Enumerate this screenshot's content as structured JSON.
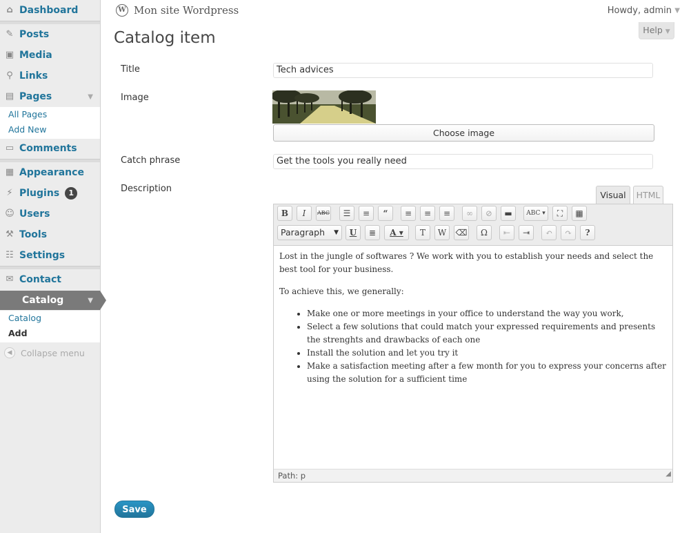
{
  "sidebar": {
    "items": [
      {
        "label": "Dashboard",
        "icon": "dashboard-icon"
      },
      {
        "label": "Posts",
        "icon": "pin-icon"
      },
      {
        "label": "Media",
        "icon": "media-icon"
      },
      {
        "label": "Links",
        "icon": "link-icon"
      },
      {
        "label": "Pages",
        "icon": "pages-icon"
      },
      {
        "label": "Comments",
        "icon": "comment-icon"
      },
      {
        "label": "Appearance",
        "icon": "appearance-icon"
      },
      {
        "label": "Plugins",
        "icon": "plugin-icon",
        "badge": "1"
      },
      {
        "label": "Users",
        "icon": "users-icon"
      },
      {
        "label": "Tools",
        "icon": "tools-icon"
      },
      {
        "label": "Settings",
        "icon": "settings-icon"
      },
      {
        "label": "Contact",
        "icon": "contact-icon"
      },
      {
        "label": "Catalog",
        "icon": "catalog-icon"
      }
    ],
    "pages_submenu": [
      "All Pages",
      "Add New"
    ],
    "catalog_submenu": [
      "Catalog",
      "Add"
    ],
    "collapse_label": "Collapse menu"
  },
  "header": {
    "site_name": "Mon site Wordpress",
    "howdy": "Howdy, admin",
    "help": "Help"
  },
  "page": {
    "title": "Catalog item",
    "fields": {
      "title_label": "Title",
      "title_value": "Tech advices",
      "image_label": "Image",
      "choose_image": "Choose image",
      "catch_label": "Catch phrase",
      "catch_value": "Get the tools you really need",
      "description_label": "Description"
    },
    "editor": {
      "tab_visual": "Visual",
      "tab_html": "HTML",
      "format": "Paragraph",
      "path": "Path: p",
      "content": {
        "p1": "Lost in the jungle of softwares ? We work with you to establish your needs and select the best tool for your business.",
        "p2": "To achieve this, we generally:",
        "list": [
          "Make one or more meetings in your office to understand the way you work,",
          "Select a few solutions that could match your expressed requirements and presents the strenghts and drawbacks of each one",
          "Install the solution and let you try it",
          "Make a satisfaction meeting after a few month for you to express your concerns after using the solution for a sufficient time"
        ]
      }
    },
    "save_label": "Save"
  },
  "colors": {
    "link": "#21759b",
    "active_menu": "#7a7a7a",
    "sidebar_bg": "#ececec",
    "button": "#21759b"
  }
}
